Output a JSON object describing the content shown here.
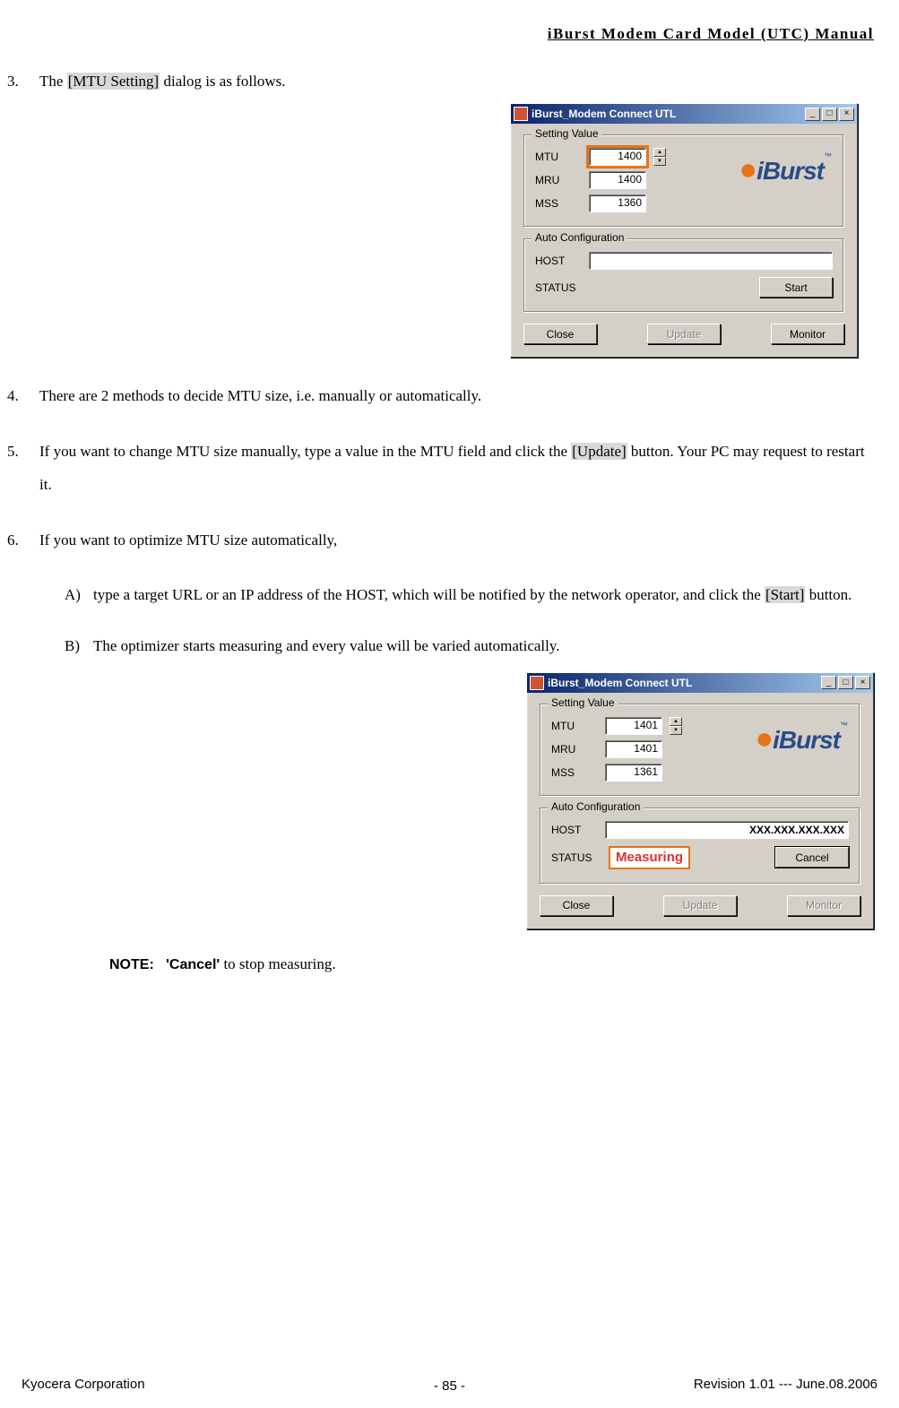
{
  "header": {
    "title": "iBurst Modem Card Model (UTC) Manual"
  },
  "items": {
    "i3_pre": "The ",
    "i3_hl": "[MTU Setting]",
    "i3_post": " dialog is as follows.",
    "i4": "There are 2 methods to decide MTU size, i.e. manually or automatically.",
    "i5_pre": "If you want to change MTU size manually, type a value in the MTU field and click the ",
    "i5_hl": "[Update]",
    "i5_post": " button.    Your PC may request to restart it.",
    "i6": "If you want to optimize MTU size automatically,",
    "i6a_pre": "type a target URL or an IP address of the HOST, which will be notified by the network operator, and click the ",
    "i6a_hl": "[Start]",
    "i6a_post": " button.",
    "i6b": "The optimizer starts measuring and every value will be varied automatically."
  },
  "markers": {
    "a": "A)",
    "b": "B)"
  },
  "dialog1": {
    "title": "iBurst_Modem Connect UTL",
    "group1": "Setting Value",
    "mtu_lbl": "MTU",
    "mtu_val": "1400",
    "mru_lbl": "MRU",
    "mru_val": "1400",
    "mss_lbl": "MSS",
    "mss_val": "1360",
    "group2": "Auto Configuration",
    "host_lbl": "HOST",
    "host_val": "",
    "status_lbl": "STATUS",
    "start_btn": "Start",
    "close_btn": "Close",
    "update_btn": "Update",
    "monitor_btn": "Monitor",
    "logo": "iBurst"
  },
  "dialog2": {
    "title": "iBurst_Modem Connect UTL",
    "group1": "Setting Value",
    "mtu_lbl": "MTU",
    "mtu_val": "1401",
    "mru_lbl": "MRU",
    "mru_val": "1401",
    "mss_lbl": "MSS",
    "mss_val": "1361",
    "group2": "Auto Configuration",
    "host_lbl": "HOST",
    "host_val": "XXX.XXX.XXX.XXX",
    "status_lbl": "STATUS",
    "status_val": "Measuring",
    "cancel_btn": "Cancel",
    "close_btn": "Close",
    "update_btn": "Update",
    "monitor_btn": "Monitor",
    "logo": "iBurst"
  },
  "note": {
    "label": "NOTE:",
    "cancel": "'Cancel'",
    "rest": " to stop measuring."
  },
  "footer": {
    "left": "Kyocera Corporation",
    "page": "- 85 -",
    "right": "Revision 1.01 --- June.08.2006"
  },
  "win": {
    "min": "_",
    "max": "□",
    "close": "×",
    "up": "▲",
    "down": "▼"
  }
}
